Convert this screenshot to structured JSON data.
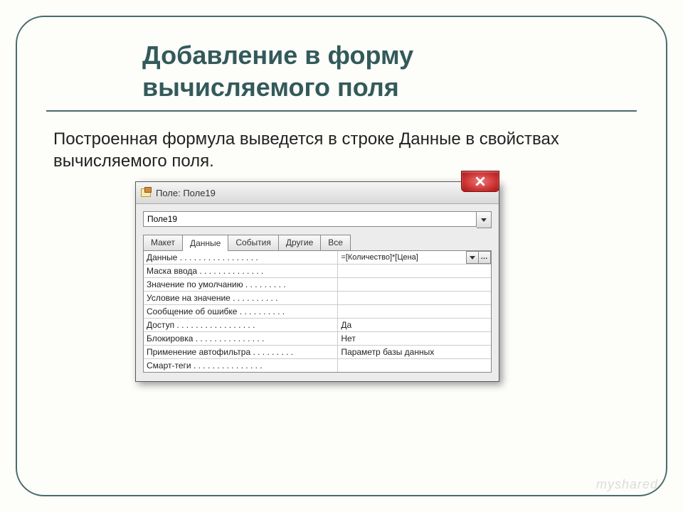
{
  "title_line1": "Добавление в форму",
  "title_line2": "вычисляемого поля",
  "description": "Построенная формула выведется в строке Данные в свойствах вычисляемого поля.",
  "watermark": "myshared",
  "window": {
    "title": "Поле: Поле19",
    "selector_value": "Поле19",
    "tabs": [
      "Макет",
      "Данные",
      "События",
      "Другие",
      "Все"
    ],
    "active_tab_index": 1,
    "rows": [
      {
        "label": "Данные",
        "value": "=[Количество]*[Цена]",
        "has_buttons": true
      },
      {
        "label": "Маска ввода",
        "value": ""
      },
      {
        "label": "Значение по умолчанию",
        "value": ""
      },
      {
        "label": "Условие на значение",
        "value": ""
      },
      {
        "label": "Сообщение об ошибке",
        "value": ""
      },
      {
        "label": "Доступ",
        "value": "Да"
      },
      {
        "label": "Блокировка",
        "value": "Нет"
      },
      {
        "label": "Применение автофильтра",
        "value": "Параметр базы данных"
      },
      {
        "label": "Смарт-теги",
        "value": ""
      }
    ]
  }
}
